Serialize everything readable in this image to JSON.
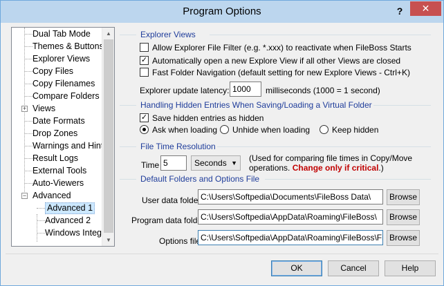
{
  "window": {
    "title": "Program Options",
    "help_glyph": "?",
    "close_glyph": "✕"
  },
  "tree": {
    "items": [
      {
        "label": "Dual Tab Mode"
      },
      {
        "label": "Themes & Buttons"
      },
      {
        "label": "Explorer Views"
      },
      {
        "label": "Copy Files"
      },
      {
        "label": "Copy Filenames"
      },
      {
        "label": "Compare Folders"
      },
      {
        "label": "Views"
      },
      {
        "label": "Date Formats"
      },
      {
        "label": "Drop Zones"
      },
      {
        "label": "Warnings and Hint"
      },
      {
        "label": "Result Logs"
      },
      {
        "label": "External Tools"
      },
      {
        "label": "Auto-Viewers"
      },
      {
        "label": "Advanced"
      },
      {
        "label": "Advanced 1"
      },
      {
        "label": "Advanced 2"
      },
      {
        "label": "Windows Integr"
      }
    ],
    "views_expander": "+",
    "advanced_expander": "−",
    "scroll_up": "▲",
    "scroll_down": "▼"
  },
  "explorer_views": {
    "heading": "Explorer Views",
    "opt1": {
      "label": "Allow Explorer File Filter (e.g. *.xxx) to reactivate when FileBoss Starts",
      "checked": false
    },
    "opt2": {
      "label": "Automatically open a new Explore View if all other Views are closed",
      "checked": true,
      "mark": "✓"
    },
    "opt3": {
      "label": "Fast Folder Navigation (default setting for new Explore Views - Ctrl+K)",
      "checked": false
    },
    "latency_label": "Explorer update latency:",
    "latency_value": "1000",
    "latency_suffix": "milliseconds (1000 = 1 second)"
  },
  "hidden_entries": {
    "heading": "Handling Hidden Entries When Saving/Loading a Virtual Folder",
    "save_hidden": {
      "label": "Save hidden entries as hidden",
      "checked": true,
      "mark": "✓"
    },
    "radio_ask": "Ask when loading",
    "radio_unhide": "Unhide when loading",
    "radio_keep": "Keep hidden",
    "selected": "ask"
  },
  "file_time": {
    "heading": "File Time Resolution",
    "time_label": "Time",
    "time_value": "5",
    "unit_value": "Seconds",
    "unit_arrow": "▼",
    "note_line1": "(Used for comparing file times in Copy/Move",
    "note_line2": "operations.",
    "note_warning": "Change only if critical",
    "note_end": ".)"
  },
  "default_folders": {
    "heading": "Default Folders and Options File",
    "user_label": "User data folder",
    "user_value": "C:\\Users\\Softpedia\\Documents\\FileBoss Data\\",
    "program_label": "Program data folder",
    "program_value": "C:\\Users\\Softpedia\\AppData\\Roaming\\FileBoss\\",
    "options_label": "Options file",
    "options_value": "C:\\Users\\Softpedia\\AppData\\Roaming\\FileBoss\\FileBo",
    "browse_label": "Browse"
  },
  "buttons": {
    "ok": "OK",
    "cancel": "Cancel",
    "help": "Help"
  },
  "colors": {
    "heading": "#1e3c9a",
    "warning": "#c00000",
    "titlebar": "#bcd6ee",
    "close": "#c75050"
  }
}
